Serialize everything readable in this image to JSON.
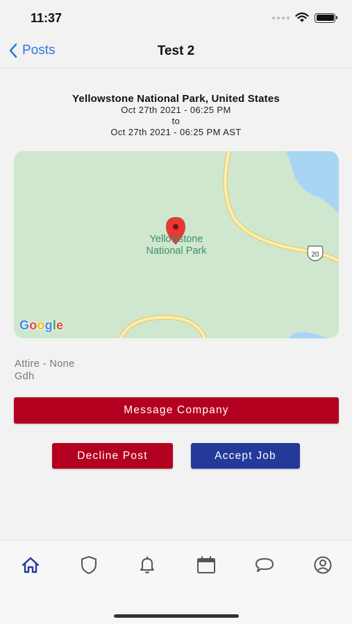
{
  "status": {
    "time": "11:37",
    "wifi_icon": "wifi-icon",
    "battery_icon": "battery-icon"
  },
  "nav": {
    "back_label": "Posts",
    "title": "Test 2",
    "back_icon": "chevron-left-icon"
  },
  "event": {
    "location": "Yellowstone National Park, United States",
    "start": "Oct 27th  2021 - 06:25 PM",
    "to": "to",
    "end": "Oct 27th  2021 - 06:25 PM AST"
  },
  "map": {
    "place_label_line1": "Yellowstone",
    "place_label_line2": "National Park",
    "route_shield": "20",
    "provider_logo": "Google",
    "pin_icon": "map-pin-icon"
  },
  "details": {
    "attire": "Attire - None",
    "note": "Gdh"
  },
  "actions": {
    "message": "Message Company",
    "decline": "Decline Post",
    "accept": "Accept Job"
  },
  "tabbar": {
    "items": [
      "home-icon",
      "shield-icon",
      "bell-icon",
      "calendar-icon",
      "chat-icon",
      "profile-icon"
    ]
  },
  "colors": {
    "accent_blue": "#2a7ae2",
    "brand_red": "#b3001f",
    "brand_navy": "#233a9a",
    "active_tab": "#233a9a",
    "inactive_tab": "#555555",
    "map_green": "#cfe7cf",
    "map_water": "#a9d5f5",
    "map_road": "#f7e39a"
  }
}
